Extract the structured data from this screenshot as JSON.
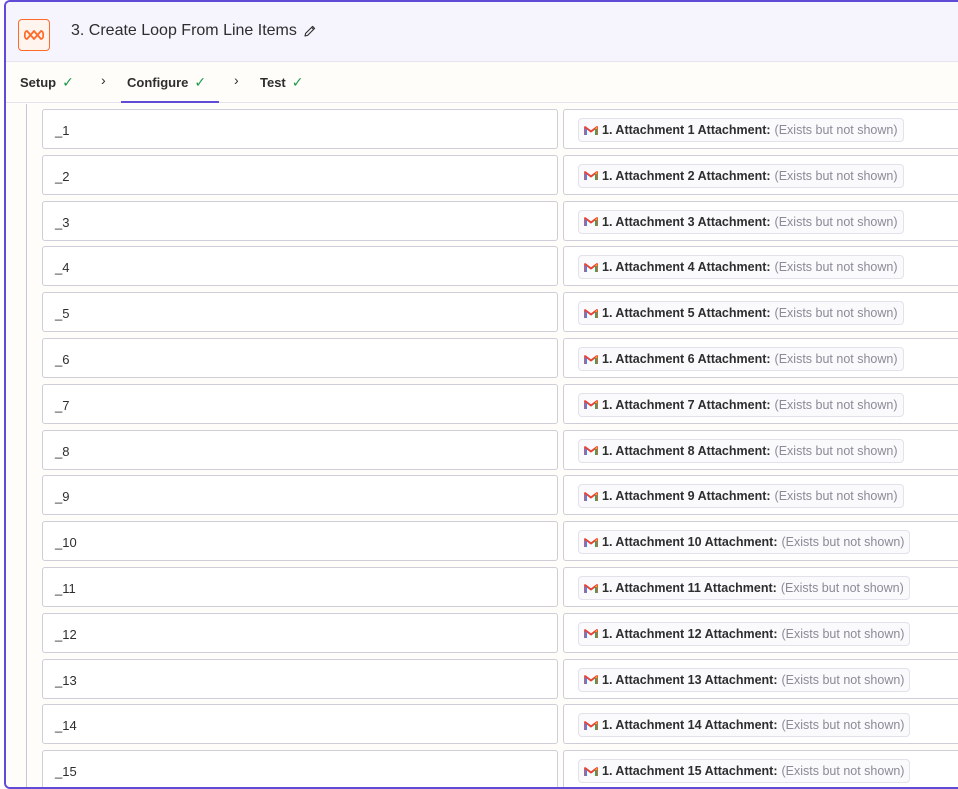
{
  "header": {
    "title": "3. Create Loop From Line Items",
    "accent_color": "#ff6a2b",
    "icons": {
      "app": "loop-icon",
      "edit": "pencil-icon"
    }
  },
  "tabs": [
    {
      "label": "Setup",
      "status": "complete",
      "active": false
    },
    {
      "label": "Configure",
      "status": "complete",
      "active": true
    },
    {
      "label": "Test",
      "status": "complete",
      "active": false
    }
  ],
  "colors": {
    "active_tab": "#5f4bd6",
    "check": "#1b9a4b"
  },
  "rows": [
    {
      "key": "_1",
      "label": "1. Attachment 1 Attachment:",
      "value": "(Exists but not shown)"
    },
    {
      "key": "_2",
      "label": "1. Attachment 2 Attachment:",
      "value": "(Exists but not shown)"
    },
    {
      "key": "_3",
      "label": "1. Attachment 3 Attachment:",
      "value": "(Exists but not shown)"
    },
    {
      "key": "_4",
      "label": "1. Attachment 4 Attachment:",
      "value": "(Exists but not shown)"
    },
    {
      "key": "_5",
      "label": "1. Attachment 5 Attachment:",
      "value": "(Exists but not shown)"
    },
    {
      "key": "_6",
      "label": "1. Attachment 6 Attachment:",
      "value": "(Exists but not shown)"
    },
    {
      "key": "_7",
      "label": "1. Attachment 7 Attachment:",
      "value": "(Exists but not shown)"
    },
    {
      "key": "_8",
      "label": "1. Attachment 8 Attachment:",
      "value": "(Exists but not shown)"
    },
    {
      "key": "_9",
      "label": "1. Attachment 9 Attachment:",
      "value": "(Exists but not shown)"
    },
    {
      "key": "_10",
      "label": "1. Attachment 10 Attachment:",
      "value": "(Exists but not shown)"
    },
    {
      "key": "_11",
      "label": "1. Attachment 11 Attachment:",
      "value": "(Exists but not shown)"
    },
    {
      "key": "_12",
      "label": "1. Attachment 12 Attachment:",
      "value": "(Exists but not shown)"
    },
    {
      "key": "_13",
      "label": "1. Attachment 13 Attachment:",
      "value": "(Exists but not shown)"
    },
    {
      "key": "_14",
      "label": "1. Attachment 14 Attachment:",
      "value": "(Exists but not shown)"
    },
    {
      "key": "_15",
      "label": "1. Attachment 15 Attachment:",
      "value": "(Exists but not shown)"
    }
  ]
}
